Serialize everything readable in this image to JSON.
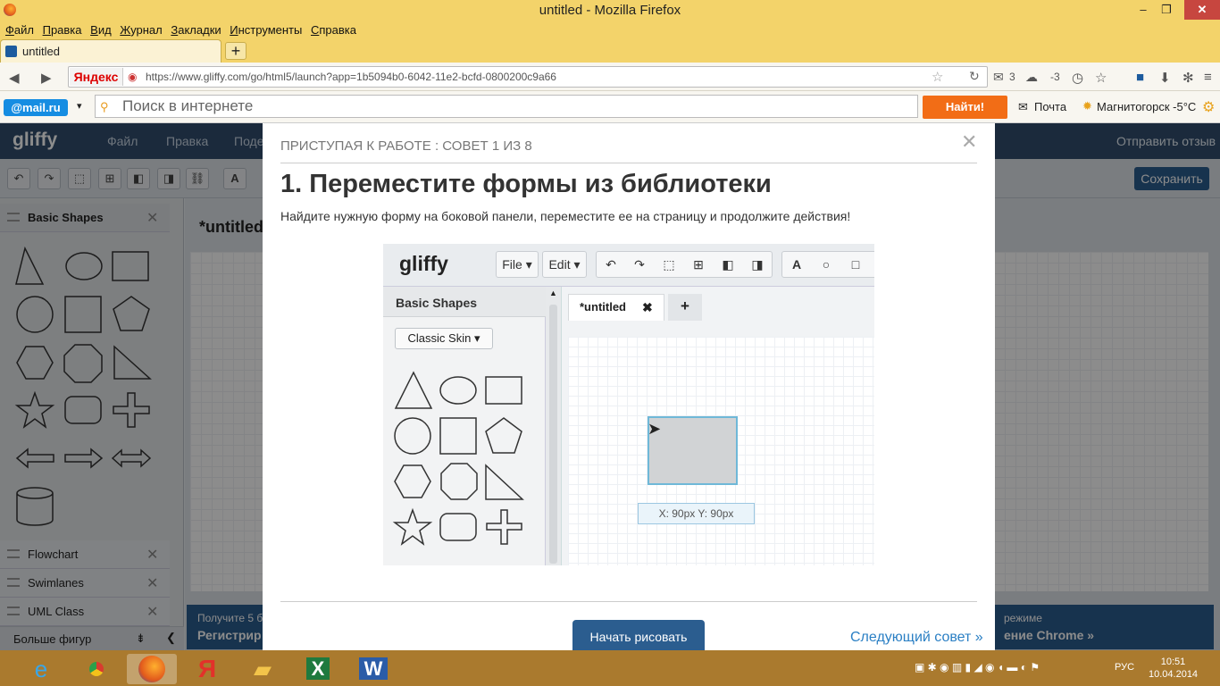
{
  "window": {
    "title": "untitled - Mozilla Firefox",
    "close_glyph": "✕",
    "min_glyph": "‒",
    "max_glyph": "❐"
  },
  "menubar": [
    "Файл",
    "Правка",
    "Вид",
    "Журнал",
    "Закладки",
    "Инструменты",
    "Справка"
  ],
  "tab": {
    "title": "untitled",
    "new_tab": "+"
  },
  "nav": {
    "yandex_label": "Яндекс",
    "url": "https://www.gliffy.com/go/html5/launch?app=1b5094b0-6042-11e2-bcfd-0800200c9a66",
    "mail_count": "3",
    "weather_temp": "-3"
  },
  "searchbar": {
    "mailru": "@mail.ru",
    "placeholder": "Поиск в интернете",
    "find_button": "Найти!",
    "mail_link": "Почта",
    "weather": "Магнитогорск -5°C"
  },
  "app": {
    "logo": "gliffy",
    "menus": [
      "Файл",
      "Правка",
      "Поде"
    ],
    "feedback": "Отправить отзыв",
    "save": "Сохранить",
    "doc_title": "*untitled",
    "panel_title": "Basic Shapes",
    "libraries": [
      "Flowchart",
      "Swimlanes",
      "UML Class"
    ],
    "more_shapes": "Больше фигур",
    "promo_left_1": "Получите 5 б",
    "promo_left_2": "Регистрир",
    "promo_right_1": "режиме",
    "promo_right_2": "ение Chrome »"
  },
  "modal": {
    "header": "ПРИСТУПАЯ К РАБОТЕ :  СОВЕТ 1 ИЗ 8",
    "title": "1. Переместите формы из библиотеки",
    "description": "Найдите нужную форму на боковой панели, переместите ее на страницу и продолжите действия!",
    "start_button": "Начать рисовать",
    "next_tip": "Следующий совет »"
  },
  "preview": {
    "logo": "gliffy",
    "file_menu": "File",
    "edit_menu": "Edit",
    "panel_title": "Basic Shapes",
    "skin": "Classic Skin",
    "tab": "*untitled",
    "position": "X: 90px Y: 90px"
  },
  "taskbar": {
    "lang": "РУС",
    "time": "10:51",
    "date": "10.04.2014"
  }
}
